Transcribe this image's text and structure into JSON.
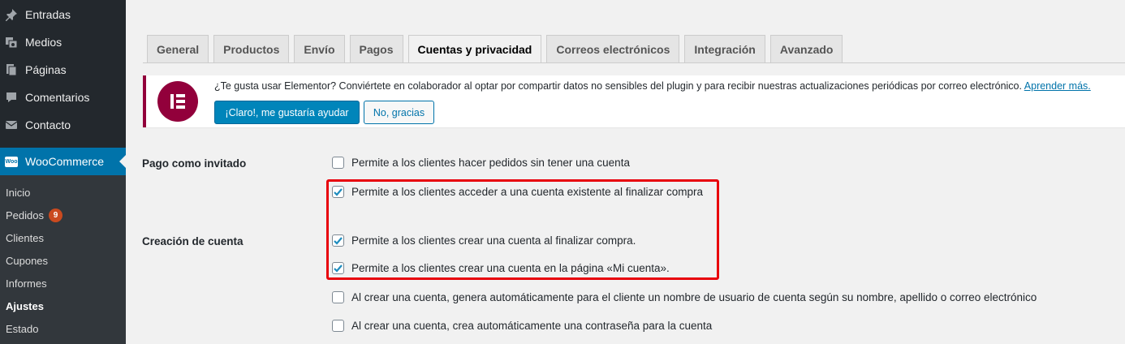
{
  "sidebar": {
    "menu": [
      {
        "label": "Entradas",
        "icon": "pin-icon"
      },
      {
        "label": "Medios",
        "icon": "media-icon"
      },
      {
        "label": "Páginas",
        "icon": "pages-icon"
      },
      {
        "label": "Comentarios",
        "icon": "comment-icon"
      },
      {
        "label": "Contacto",
        "icon": "mail-icon"
      }
    ],
    "woocommerce": {
      "label": "WooCommerce",
      "logo": "Woo"
    },
    "submenu": [
      {
        "label": "Inicio"
      },
      {
        "label": "Pedidos",
        "badge": "9"
      },
      {
        "label": "Clientes"
      },
      {
        "label": "Cupones"
      },
      {
        "label": "Informes"
      },
      {
        "label": "Ajustes"
      },
      {
        "label": "Estado"
      }
    ]
  },
  "tabs": [
    "General",
    "Productos",
    "Envío",
    "Pagos",
    "Cuentas y privacidad",
    "Correos electrónicos",
    "Integración",
    "Avanzado"
  ],
  "active_tab": "Cuentas y privacidad",
  "notice": {
    "text": "¿Te gusta usar Elementor? Conviértete en colaborador al optar por compartir datos no sensibles del plugin y para recibir nuestras actualizaciones periódicas por correo electrónico.",
    "link": "Aprender más.",
    "accept": "¡Claro!, me gustaría ayudar",
    "decline": "No, gracias"
  },
  "settings": {
    "guest_label": "Pago como invitado",
    "account_label": "Creación de cuenta",
    "options": [
      {
        "label": "Permite a los clientes hacer pedidos sin tener una cuenta",
        "checked": false
      },
      {
        "label": "Permite a los clientes acceder a una cuenta existente al finalizar compra",
        "checked": true
      },
      {
        "label": "Permite a los clientes crear una cuenta al finalizar compra.",
        "checked": true
      },
      {
        "label": "Permite a los clientes crear una cuenta en la página «Mi cuenta».",
        "checked": true
      },
      {
        "label": "Al crear una cuenta, genera automáticamente para el cliente un nombre de usuario de cuenta según su nombre, apellido o correo electrónico",
        "checked": false
      },
      {
        "label": "Al crear una cuenta, crea automáticamente una contraseña para la cuenta",
        "checked": false
      }
    ]
  },
  "colors": {
    "accent": "#0073aa",
    "highlight": "#e8000b",
    "elementor": "#92003b"
  }
}
